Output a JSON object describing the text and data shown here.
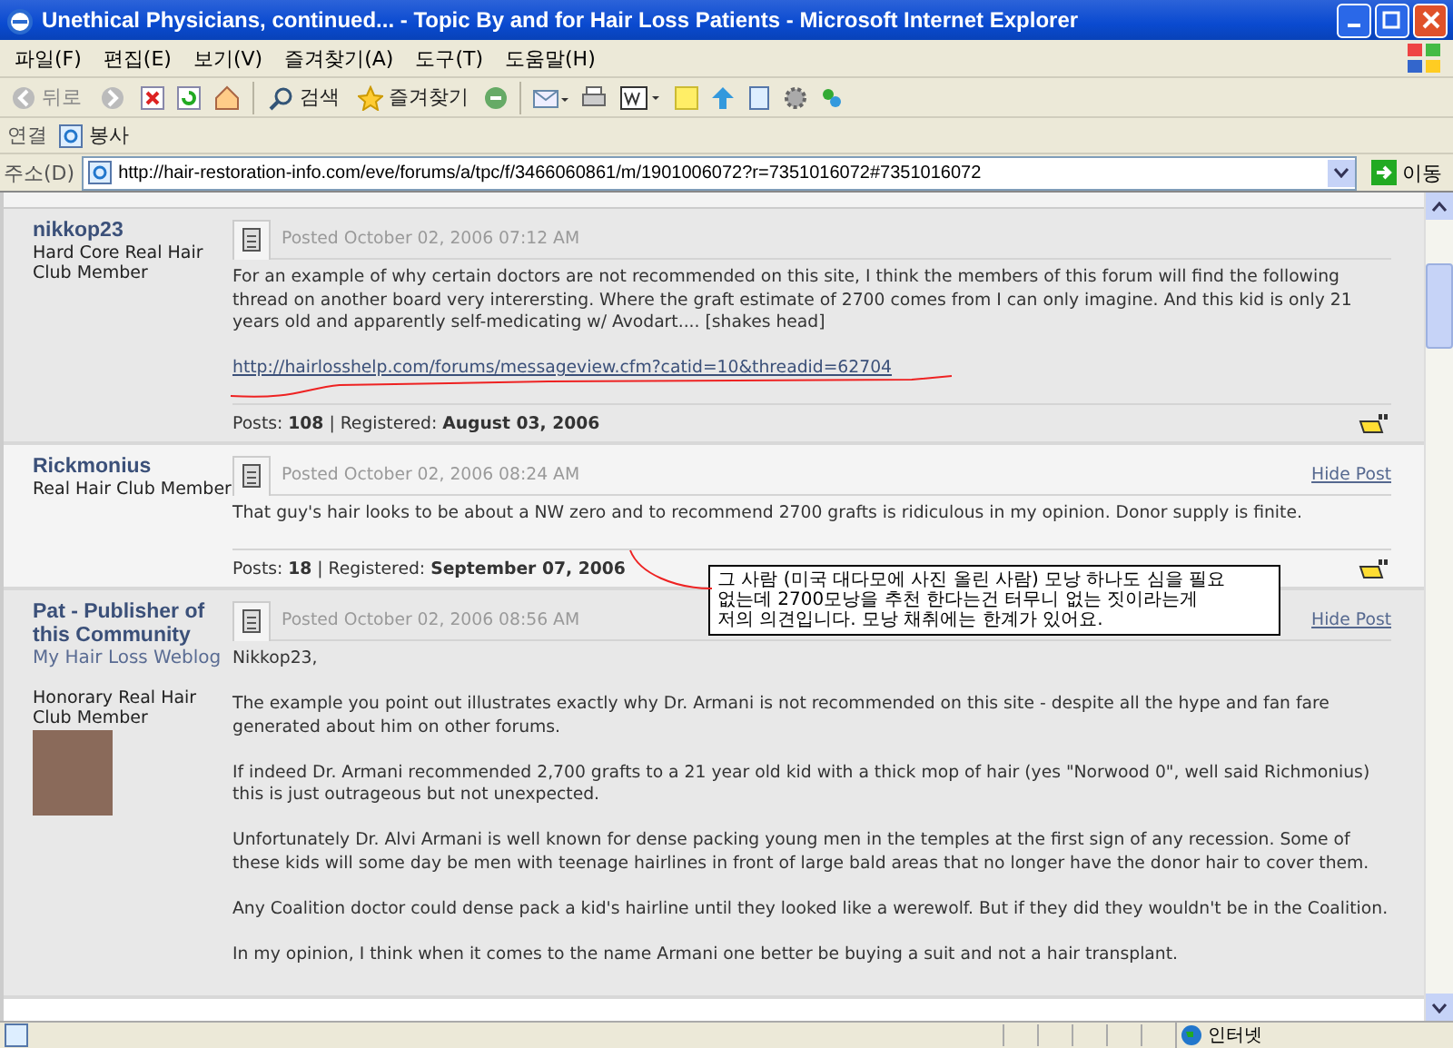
{
  "window": {
    "title": "Unethical Physicians, continued... - Topic By and for Hair Loss Patients - Microsoft Internet Explorer"
  },
  "menu": [
    "파일(F)",
    "편집(E)",
    "보기(V)",
    "즐겨찾기(A)",
    "도구(T)",
    "도움말(H)"
  ],
  "toolbar": {
    "back": "뒤로",
    "search": "검색",
    "favorites": "즐겨찾기"
  },
  "links_bar": {
    "label": "연결",
    "item": "봉사"
  },
  "address_bar": {
    "label": "주소(D)",
    "url": "http://hair-restoration-info.com/eve/forums/a/tpc/f/3466060861/m/1901006072?r=7351016072#7351016072",
    "go": "이동"
  },
  "posts": [
    {
      "author": "nikkop23",
      "rank": "Hard Core Real Hair Club Member",
      "posted": "Posted October 02, 2006 07:12 AM",
      "shaded": true,
      "body": [
        "For an example of why certain doctors are not recommended on this site, I think the members of this forum will find the following thread on another board very interersting. Where the graft estimate of 2700 comes from I can only imagine. And this kid is only 21 years old and apparently self-medicating w/ Avodart.... [shakes head]"
      ],
      "link": "http://hairlosshelp.com/forums/messageview.cfm?catid=10&threadid=62704",
      "footer": "Posts: **108** | Registered: **August 03, 2006**"
    },
    {
      "author": "Rickmonius",
      "rank": "Real Hair Club Member",
      "posted": "Posted October 02, 2006 08:24 AM",
      "hide": "Hide Post",
      "shaded": false,
      "body": [
        "That guy's hair looks to be about a NW zero and to recommend 2700 grafts is ridiculous in my opinion. Donor supply is finite."
      ],
      "footer": "Posts: **18** | Registered: **September 07, 2006**"
    },
    {
      "author": "Pat - Publisher of this Community",
      "weblog": "My Hair Loss Weblog",
      "rank": "Honorary Real Hair Club Member",
      "avatar": true,
      "posted": "Posted October 02, 2006 08:56 AM",
      "hide": "Hide Post",
      "shaded": true,
      "body": [
        "Nikkop23,",
        "The example you point out illustrates exactly why Dr. Armani is not recommended on this site - despite all the hype and fan fare generated about him on other forums.",
        "If indeed Dr. Armani recommended 2,700 grafts to a 21 year old kid with a thick mop of hair (yes \"Norwood 0\", well said Richmonius) this is just outrageous but not unexpected.",
        "Unfortunately Dr. Alvi Armani is well known for dense packing young men in the temples at the first sign of any recession. Some of these kids will some day be men with teenage hairlines in front of large bald areas that no longer have the donor hair to cover them.",
        "Any Coalition doctor could dense pack a kid's hairline until they looked like a werewolf. But if they did they wouldn't be in the Coalition.",
        "In my opinion, I think when it comes to the name Armani one better be buying a suit and not a hair transplant."
      ]
    }
  ],
  "annotation": {
    "lines": [
      "그 사람 (미국 대다모에 사진 올린 사람) 모낭 하나도 심을 필요",
      "없는데 2700모낭을 추천 한다는건 터무니 없는 짓이라는게",
      "저의 의견입니다. 모낭 채취에는 한계가 있어요."
    ]
  },
  "status_bar": {
    "zone": "인터넷"
  }
}
